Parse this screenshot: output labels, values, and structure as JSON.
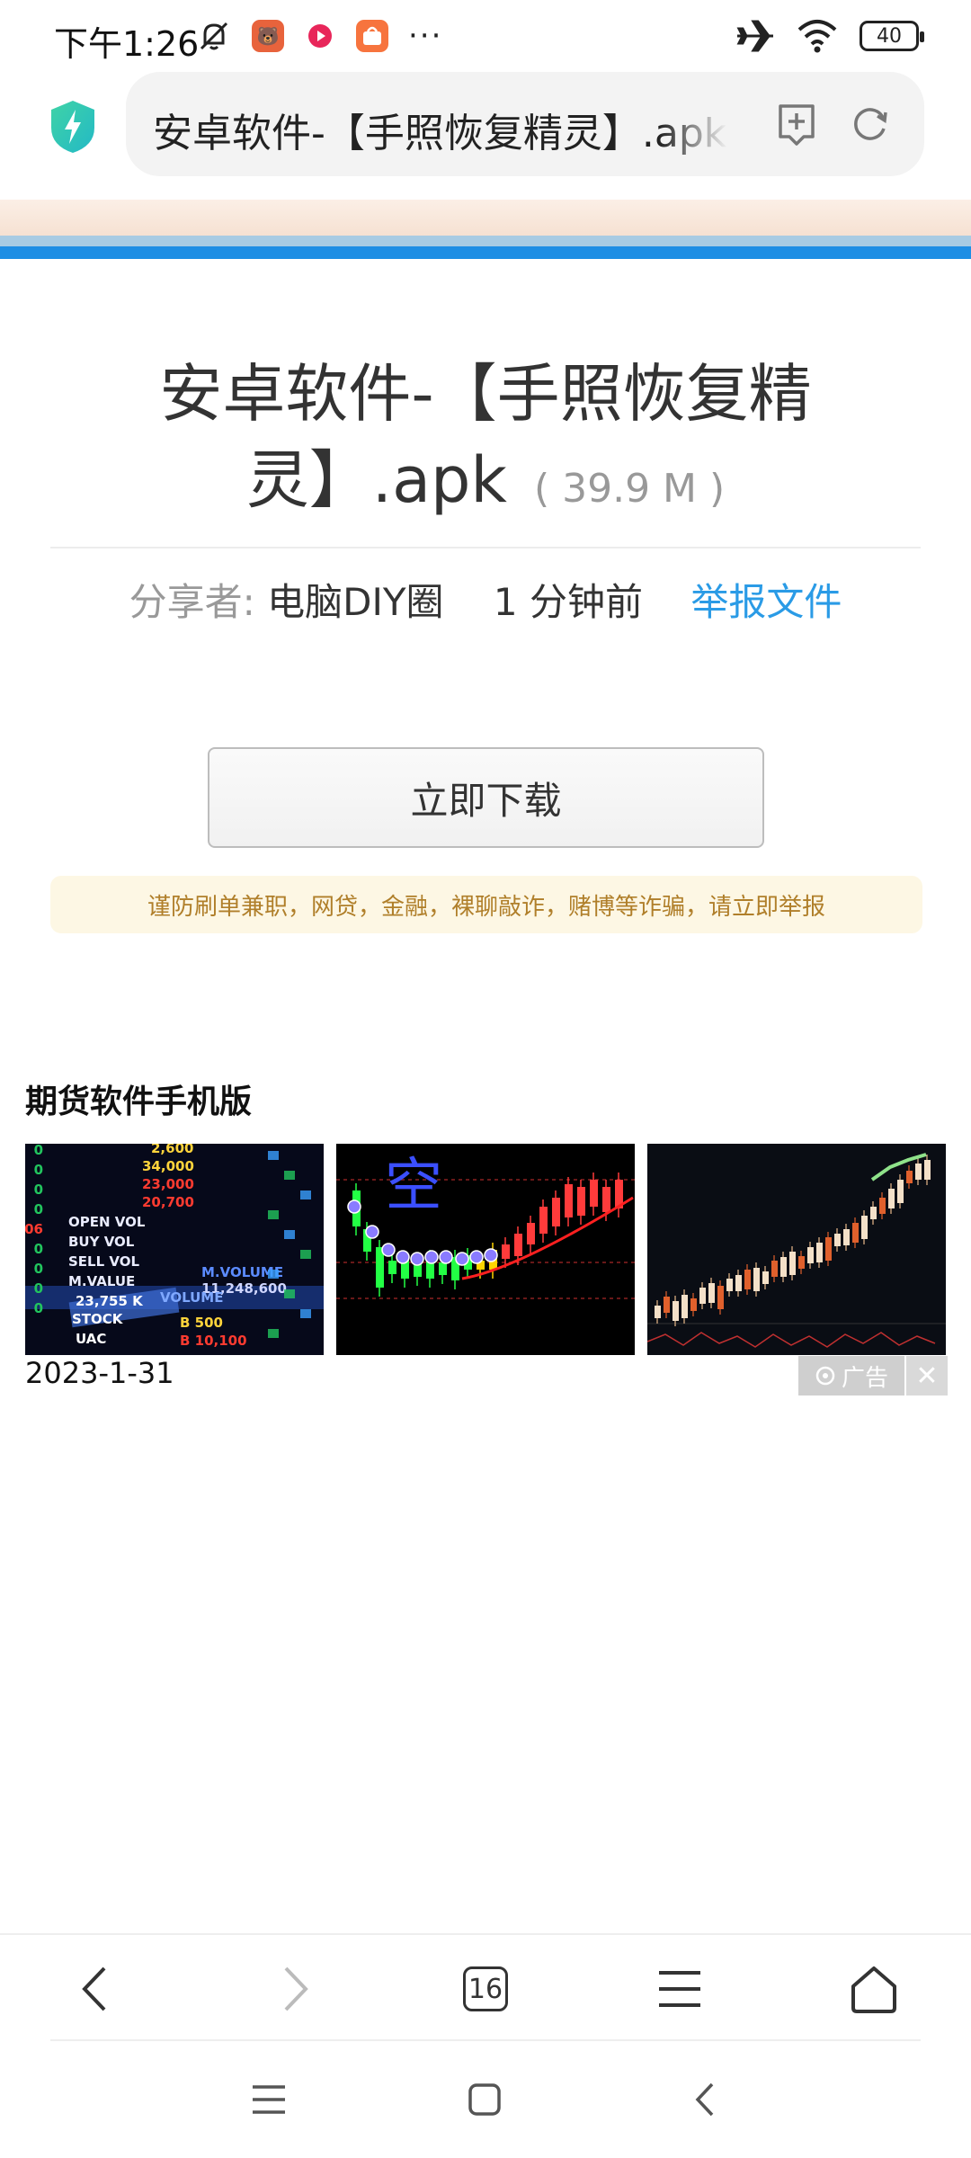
{
  "status_bar": {
    "time": "下午1:26",
    "battery": "40"
  },
  "url_bar": {
    "url_text": "安卓软件-【手照恢复精灵】.apk"
  },
  "file": {
    "title": "安卓软件-【手照恢复精灵】.apk",
    "size": "( 39.9 M )",
    "share_label": "分享者:",
    "share_user": "电脑DIY圈",
    "share_time": "1 分钟前",
    "report_link": "举报文件"
  },
  "download_button": "立即下载",
  "warning": "谨防刷单兼职，网贷，金融，裸聊敲诈，赌博等诈骗，请立即举报",
  "ad": {
    "title": "期货软件手机版",
    "date": "2023-1-31",
    "label": "广告",
    "close": "✕",
    "ticker_lines": [
      "2,600",
      "34,000",
      "23,000",
      "20,700",
      "OPEN VOL",
      "BUY VOL",
      "SELL VOL",
      "M.VALUE",
      "23,755 K",
      "STOCK",
      "UAC",
      "VOLUME",
      "M.VOLUME",
      "B 500",
      "B 10,100",
      "11,248,600"
    ],
    "chart_char": "空"
  },
  "browser_nav": {
    "tabs_count": "16"
  },
  "colors": {
    "accent_blue": "#1e8ee4",
    "link_blue": "#2a9be6",
    "warning_text": "#b07f2a",
    "warning_bg": "#fdf7e4"
  }
}
